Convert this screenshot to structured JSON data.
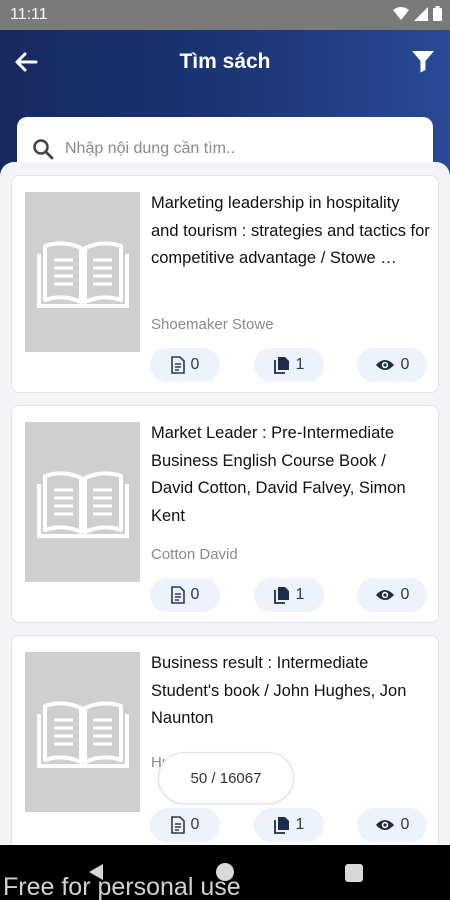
{
  "status_bar": {
    "time": "11:11"
  },
  "header": {
    "title": "Tìm sách"
  },
  "search": {
    "placeholder": "Nhập nội dung cần tìm.."
  },
  "books": [
    {
      "title": "Marketing leadership in hospitality and tourism : strategies and tactics for competitive advantage / Stowe …",
      "author": "Shoemaker Stowe",
      "stats": {
        "documents": "0",
        "copies": "1",
        "views": "0"
      }
    },
    {
      "title": "Market Leader : Pre-Intermediate Business English Course Book / David Cotton, David Falvey, Simon Kent",
      "author": "Cotton David",
      "stats": {
        "documents": "0",
        "copies": "1",
        "views": "0"
      }
    },
    {
      "title": "Business result : Intermediate Student's book / John Hughes, Jon Naunton",
      "author": "Hughes John",
      "stats": {
        "documents": "0",
        "copies": "1",
        "views": "0"
      }
    }
  ],
  "pager": {
    "text": "50 / 16067"
  },
  "watermark": "Free for personal use",
  "colors": {
    "header": "#1d3677",
    "accent": "#0f1f4f",
    "chip_bg": "#eef3fb",
    "thumb": "#cfcfcf"
  }
}
